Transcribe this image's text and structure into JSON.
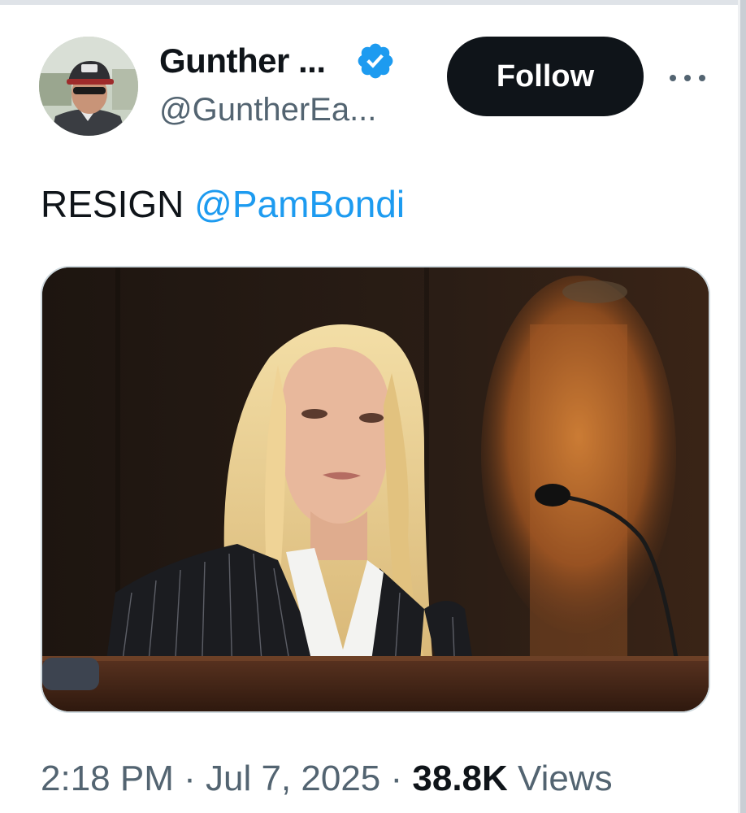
{
  "author": {
    "display_name": "Gunther ...",
    "handle": "@GuntherEa...",
    "avatar_icon": "profile-photo",
    "verified_icon": "verified-badge-icon"
  },
  "actions": {
    "follow_label": "Follow",
    "more_icon": "more-dots-icon"
  },
  "tweet": {
    "text": "RESIGN ",
    "mention": "@PamBondi",
    "media_description": "photo"
  },
  "meta": {
    "time": "2:18 PM",
    "sep1": " · ",
    "date": "Jul 7, 2025",
    "sep2": " · ",
    "views_count": "38.8K",
    "views_label": " Views"
  },
  "colors": {
    "link": "#1d9bf0",
    "text": "#0f1419",
    "secondary": "#536471",
    "button_bg": "#0f1419"
  }
}
